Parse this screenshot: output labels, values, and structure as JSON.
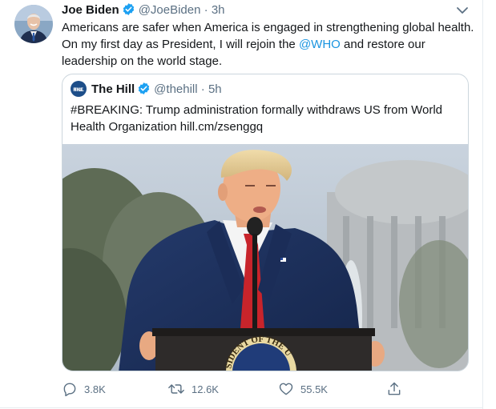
{
  "tweet": {
    "author_name": "Joe Biden",
    "handle": "@JoeBiden",
    "separator": "·",
    "time": "3h",
    "text_before": "Americans are safer when America is engaged in strengthening global health. On my first day as President, I will rejoin the ",
    "mention": "@WHO",
    "text_after": " and restore our leadership on the world stage."
  },
  "quote": {
    "logo_text_line1": "THE",
    "logo_text_line2": "HILL",
    "author_name": "The Hill",
    "handle": "@thehill",
    "separator": "·",
    "time": "5h",
    "text": "#BREAKING: Trump administration formally withdraws US from World Health Organization hill.cm/zsenggq",
    "seal_text": "SIDENT OF THE U"
  },
  "actions": {
    "replies": "3.8K",
    "retweets": "12.6K",
    "likes": "55.5K"
  },
  "colors": {
    "link": "#1b95e0",
    "verified": "#1da1f2",
    "muted": "#5b7083"
  },
  "icons": [
    "avatar-photo",
    "verified-badge-icon",
    "chevron-down-icon",
    "reply-icon",
    "retweet-icon",
    "like-icon",
    "share-icon"
  ]
}
